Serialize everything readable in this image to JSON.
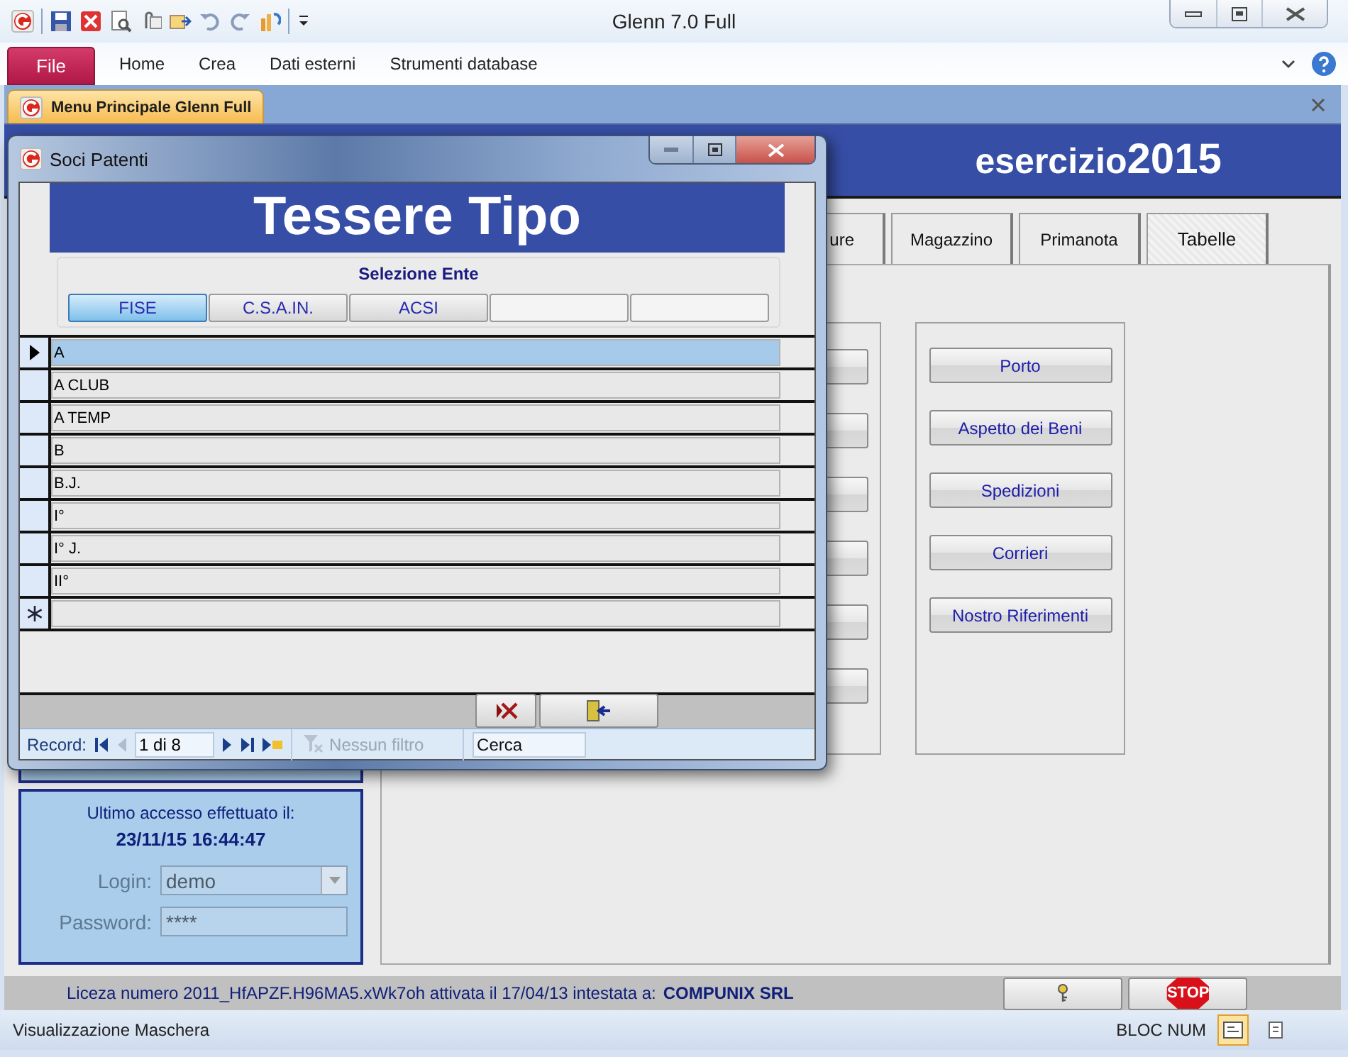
{
  "window": {
    "title": "Glenn 7.0 Full"
  },
  "ribbon": {
    "file_button": "File",
    "tabs": [
      "Home",
      "Crea",
      "Dati esterni",
      "Strumenti database"
    ]
  },
  "document_tab": {
    "label": "Menu Principale Glenn Full"
  },
  "form": {
    "year_label": "esercizio",
    "year": "2015",
    "tabs": [
      {
        "label": "ure",
        "selected": false
      },
      {
        "label": "Magazzino",
        "selected": false
      },
      {
        "label": "Primanota",
        "selected": false
      },
      {
        "label": "Tabelle",
        "selected": true
      }
    ],
    "table_buttons": [
      "Porto",
      "Aspetto dei Beni",
      "Spedizioni",
      "Corrieri",
      "Nostro Riferimenti"
    ],
    "last_access": {
      "label": "Ultimo accesso effettuato il:",
      "value": "23/11/15 16:44:47"
    },
    "login": {
      "label": "Login:",
      "value": "demo",
      "disabled": true
    },
    "password": {
      "label": "Password:",
      "value": "****",
      "disabled": true
    }
  },
  "license": {
    "text": "Liceza numero 2011_HfAPZF.H96MA5.xWk7oh attivata il 17/04/13 intestata a:",
    "company": "COMPUNIX SRL",
    "stop_button": "STOP"
  },
  "status_bar": {
    "text": "Visualizzazione Maschera",
    "indicator": "BLOC NUM"
  },
  "dialog": {
    "title": "Soci Patenti",
    "heading": "Tessere Tipo",
    "group_label": "Selezione Ente",
    "entities": [
      {
        "label": "FISE",
        "selected": true
      },
      {
        "label": "C.S.A.IN.",
        "selected": false
      },
      {
        "label": "ACSI",
        "selected": false
      }
    ],
    "rows": [
      {
        "value": "A",
        "selected": true
      },
      {
        "value": "A CLUB",
        "selected": false
      },
      {
        "value": "A TEMP",
        "selected": false
      },
      {
        "value": "B",
        "selected": false
      },
      {
        "value": "B.J.",
        "selected": false
      },
      {
        "value": "I°",
        "selected": false
      },
      {
        "value": "I° J.",
        "selected": false
      },
      {
        "value": "II°",
        "selected": false
      }
    ],
    "navigation": {
      "label": "Record:",
      "position": "1 di 8",
      "filter": "Nessun filtro",
      "search": {
        "placeholder": "Cerca"
      }
    }
  }
}
